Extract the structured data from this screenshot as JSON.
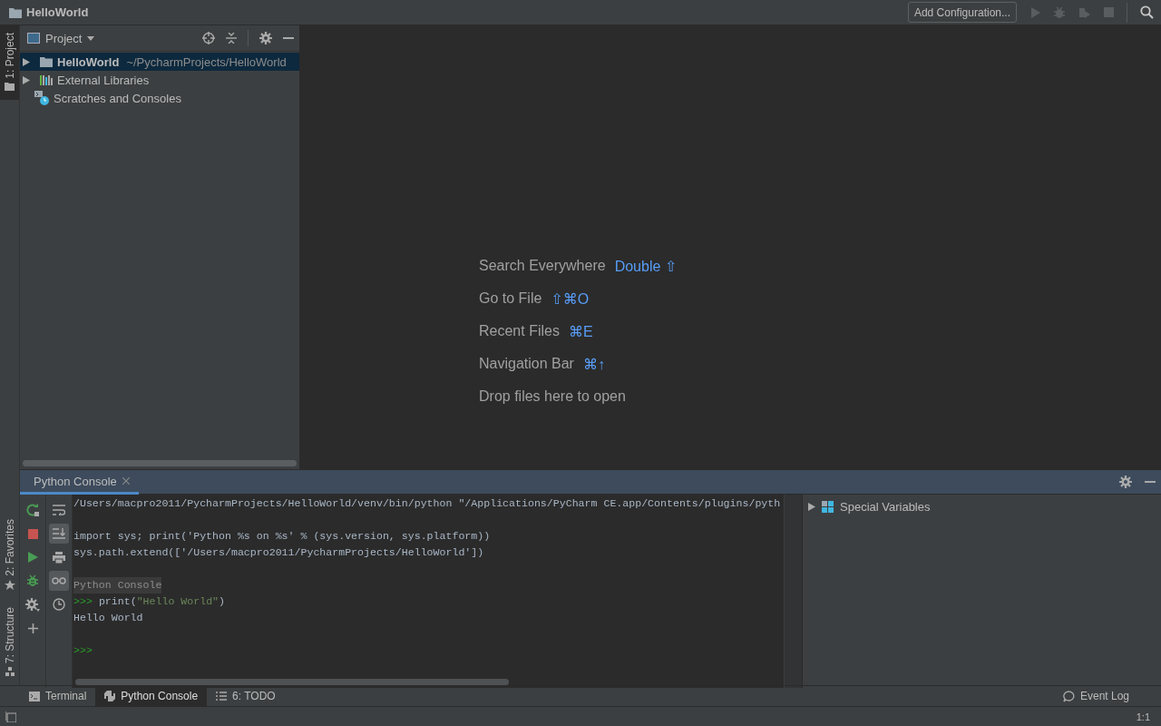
{
  "window": {
    "title": "HelloWorld"
  },
  "toolbar": {
    "config_button": "Add Configuration..."
  },
  "left_stripe": {
    "top": [
      {
        "label": "1: Project",
        "kind": "folder",
        "selected": true
      }
    ],
    "bottom": [
      {
        "label": "2: Favorites",
        "kind": "star",
        "selected": false
      },
      {
        "label": "7: Structure",
        "kind": "structure",
        "selected": false
      }
    ]
  },
  "project_panel": {
    "view": "Project",
    "items": [
      {
        "label": "HelloWorld",
        "hint": "~/PycharmProjects/HelloWorld",
        "kind": "folder",
        "expanded": false,
        "selected": true
      },
      {
        "label": "External Libraries",
        "kind": "libraries",
        "expanded": false,
        "selected": false
      },
      {
        "label": "Scratches and Consoles",
        "kind": "scratches",
        "selected": false
      }
    ]
  },
  "editor": {
    "hints": [
      {
        "label": "Search Everywhere",
        "shortcut": "Double ⇧"
      },
      {
        "label": "Go to File",
        "shortcut": "⇧⌘O"
      },
      {
        "label": "Recent Files",
        "shortcut": "⌘E"
      },
      {
        "label": "Navigation Bar",
        "shortcut": "⌘↑"
      },
      {
        "label": "Drop files here to open"
      }
    ]
  },
  "console": {
    "tab": "Python Console",
    "actions": [
      {
        "kind": "rerun"
      },
      {
        "kind": "stop"
      },
      {
        "kind": "run"
      },
      {
        "kind": "debug"
      },
      {
        "kind": "settings"
      },
      {
        "kind": "add"
      }
    ],
    "toggles": [
      {
        "kind": "wrap",
        "on": false
      },
      {
        "kind": "scroll_end",
        "on": true
      },
      {
        "kind": "print",
        "on": false
      },
      {
        "kind": "glasses",
        "on": true
      },
      {
        "kind": "history",
        "on": false
      }
    ],
    "lines": [
      {
        "kind": "output",
        "text": "/Users/macpro2011/PycharmProjects/HelloWorld/venv/bin/python \"/Applications/PyCharm CE.app/Contents/plugins/pyth"
      },
      {
        "kind": "blank"
      },
      {
        "kind": "output",
        "text": "import sys; print('Python %s on %s' % (sys.version, sys.platform))"
      },
      {
        "kind": "output",
        "text": "sys.path.extend(['/Users/macpro2011/PycharmProjects/HelloWorld'])"
      },
      {
        "kind": "blank"
      },
      {
        "kind": "header",
        "text": "Python Console"
      },
      {
        "kind": "input",
        "prompt": ">>>",
        "tokens": [
          {
            "kind": "plain",
            "text": "print("
          },
          {
            "kind": "string",
            "text": "\"Hello World\""
          },
          {
            "kind": "plain",
            "text": ")"
          }
        ]
      },
      {
        "kind": "output",
        "text": "Hello World"
      },
      {
        "kind": "blank"
      },
      {
        "kind": "input",
        "prompt": ">>>"
      }
    ],
    "variables": [
      {
        "label": "Special Variables",
        "expanded": false
      }
    ]
  },
  "tool_bar": {
    "tabs": [
      {
        "label": "Terminal",
        "kind": "terminal",
        "selected": false
      },
      {
        "label": "Python Console",
        "kind": "python",
        "selected": true
      },
      {
        "label": "6: TODO",
        "kind": "todo",
        "selected": false
      }
    ],
    "right": "Event Log"
  },
  "status_bar": {
    "position": "1:1"
  }
}
